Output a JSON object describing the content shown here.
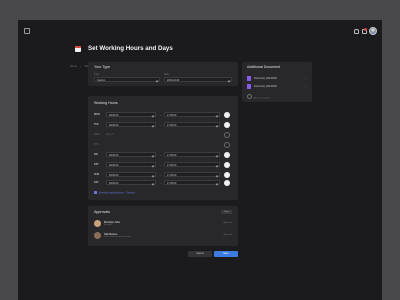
{
  "breadcrumb": [
    "Home",
    "Workspace",
    "Set Working Hours"
  ],
  "page": {
    "title": "Set Working Hours and Days"
  },
  "your_type": {
    "title": "Your Type",
    "type_label": "Type",
    "type_value": "Custom",
    "date_label": "Date",
    "date_value": "2023-10-03"
  },
  "working_hours": {
    "title": "Working Hours",
    "off_text": "Day off",
    "days": [
      {
        "day": "MON",
        "active": true,
        "start": "09:00:00",
        "end": "17:00:00"
      },
      {
        "day": "TUE",
        "active": true,
        "start": "09:00:00",
        "end": "17:00:00"
      },
      {
        "day": "WED",
        "active": false,
        "start": "",
        "end": ""
      },
      {
        "day": "THU",
        "active": false,
        "start": "",
        "end": ""
      },
      {
        "day": "FRI",
        "active": true,
        "start": "09:00:00",
        "end": "17:00:00"
      },
      {
        "day": "SAT",
        "active": true,
        "start": "09:00:00",
        "end": "17:00:00"
      },
      {
        "day": "SUN",
        "active": true,
        "start": "09:00:00",
        "end": "17:00:00"
      },
      {
        "day": "SAT",
        "active": true,
        "start": "09:00:00",
        "end": "17:00:00"
      }
    ],
    "add_link": "Schedule working hours · Shortcut"
  },
  "additional_document": {
    "title": "Additional Document",
    "files": [
      {
        "name": "Document_20231003"
      },
      {
        "name": "Document_20231003"
      }
    ],
    "upload_text": "Attach document"
  },
  "approvals": {
    "title": "Approvals",
    "button": "View",
    "people": [
      {
        "name": "Brooklyn Alba",
        "role": "Manager",
        "status": "Approved",
        "avatar_color": "#c9a27a"
      },
      {
        "name": "Nila Burkes",
        "role": "Team Lead · Human Resource",
        "status": "Approved",
        "avatar_color": "#8b6d58"
      }
    ]
  },
  "actions": {
    "cancel": "Cancel",
    "save": "Save"
  },
  "colors": {
    "accent": "#3d7be0",
    "doc_icon": "#8a5be6",
    "link": "#6d75e0"
  }
}
